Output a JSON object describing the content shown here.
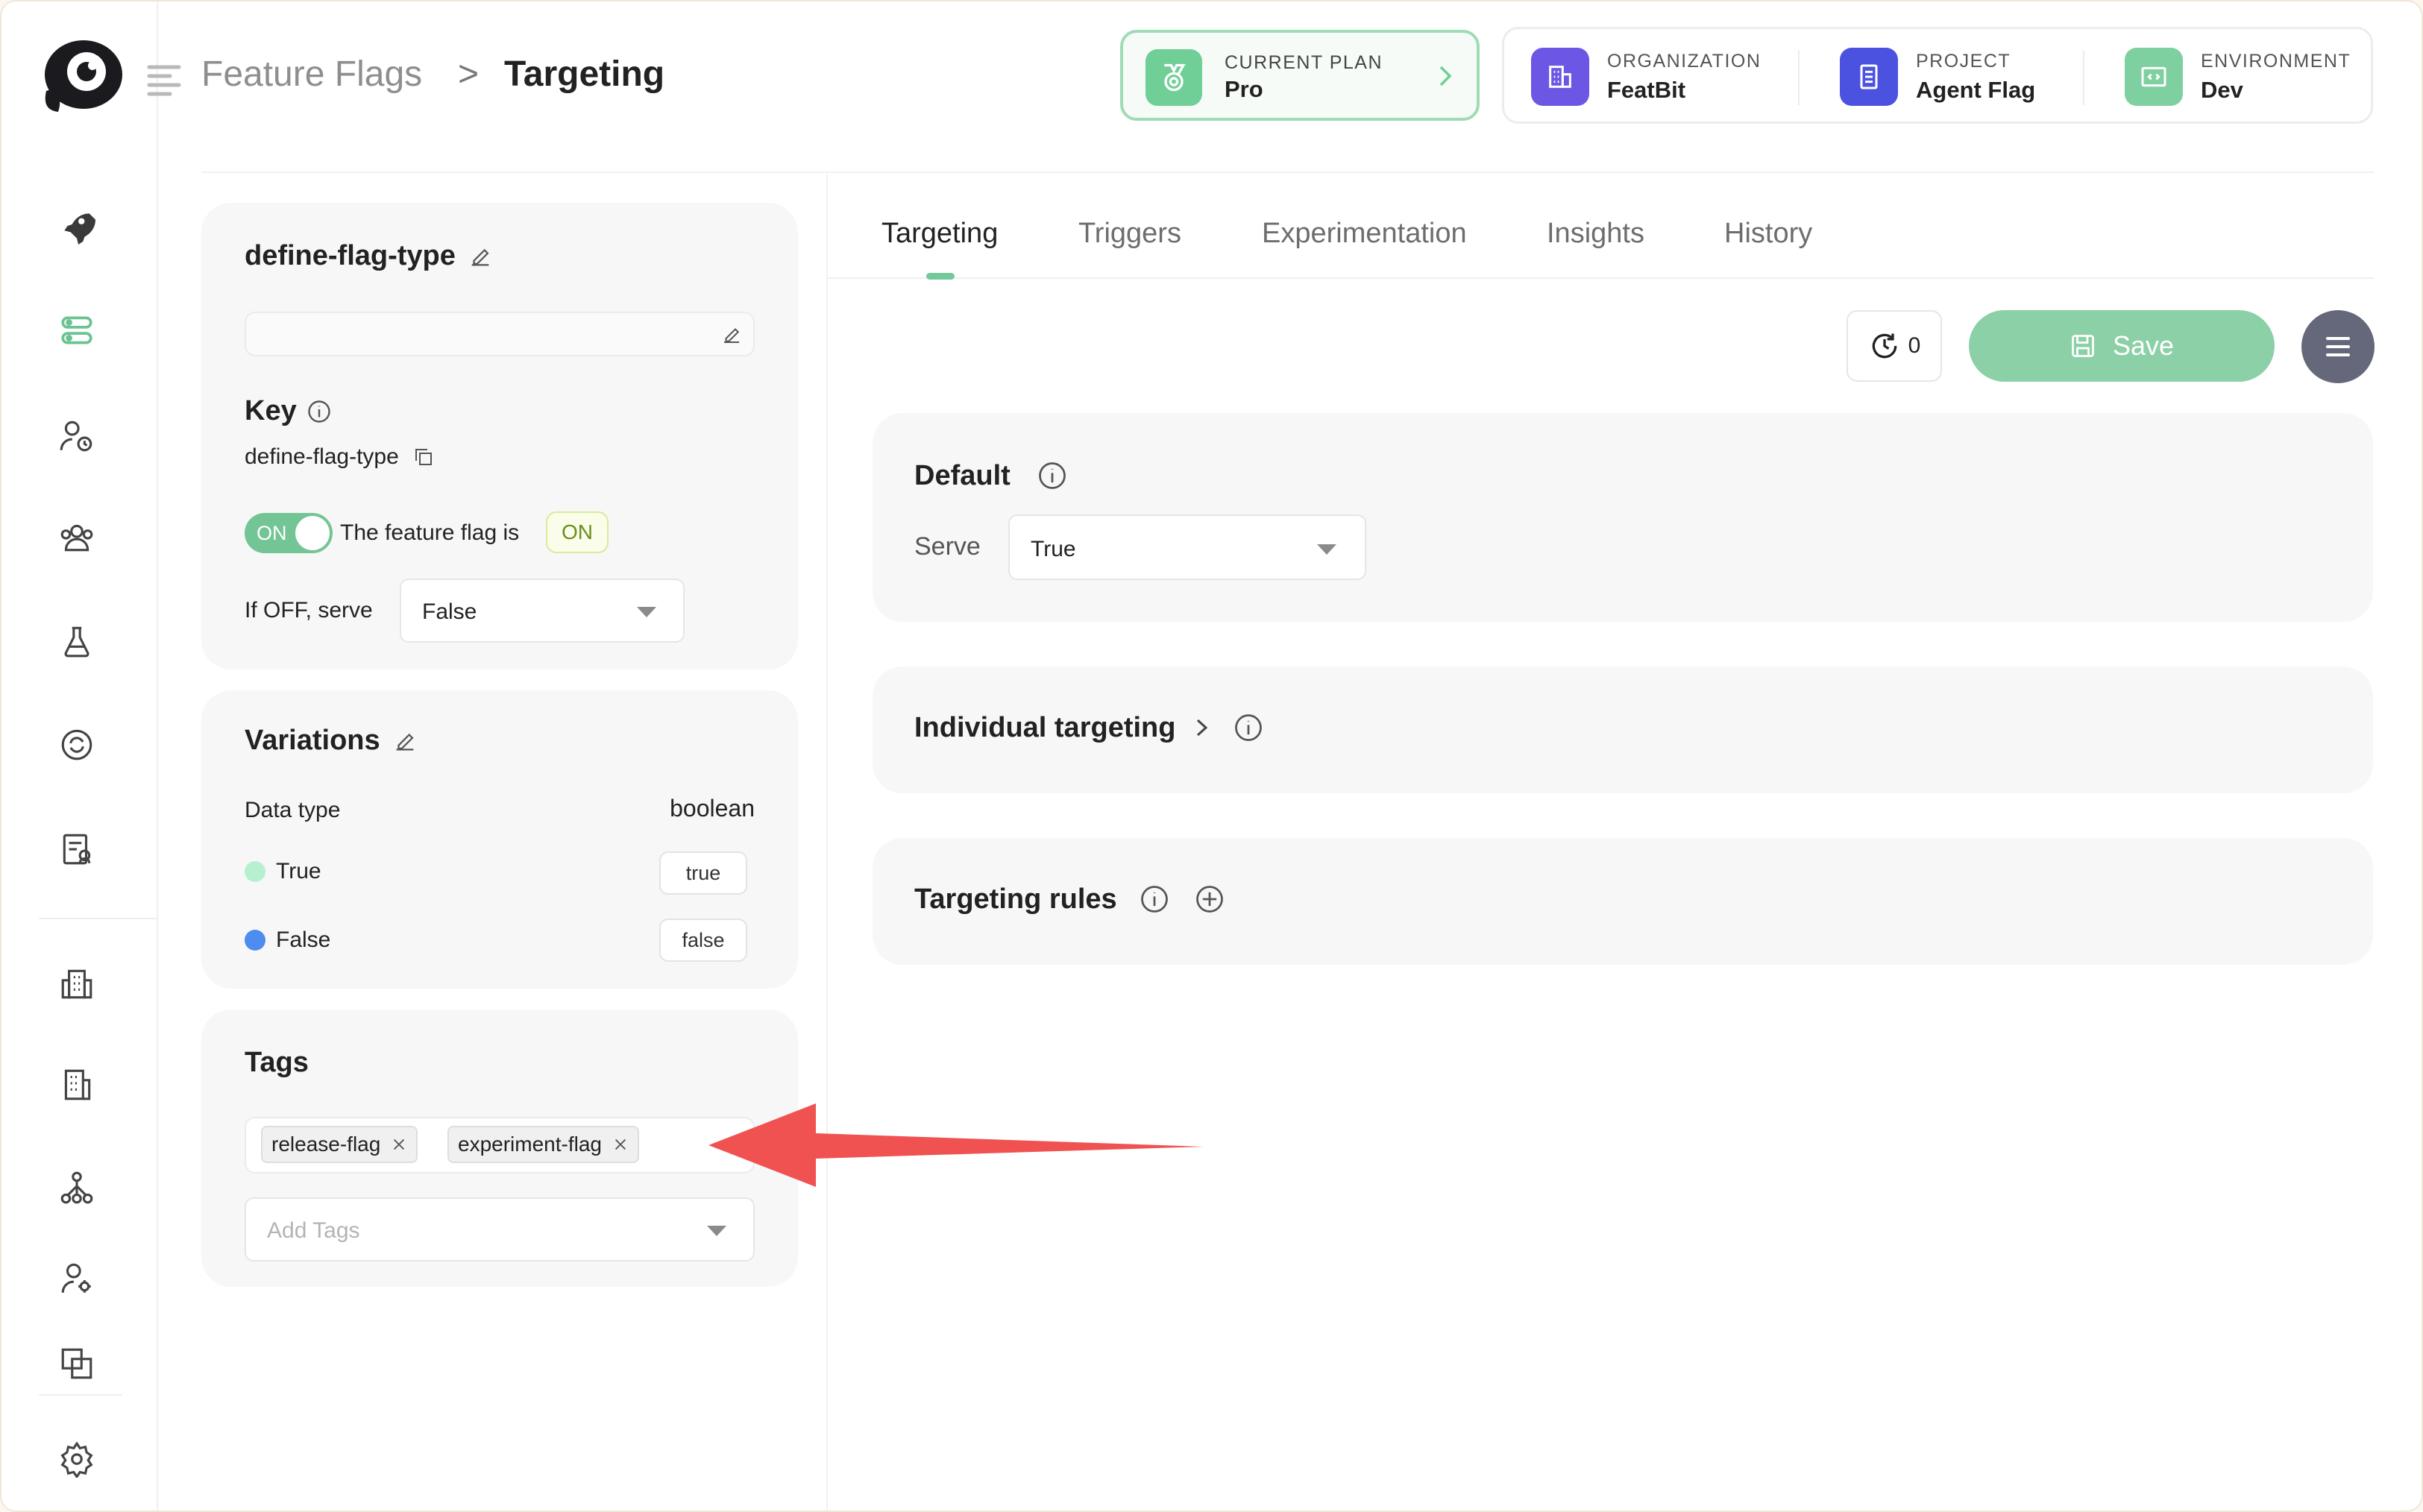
{
  "breadcrumb": {
    "section": "Feature Flags",
    "separator": ">",
    "current": "Targeting"
  },
  "plan": {
    "label": "CURRENT PLAN",
    "value": "Pro"
  },
  "context": {
    "organization": {
      "label": "ORGANIZATION",
      "value": "FeatBit"
    },
    "project": {
      "label": "PROJECT",
      "value": "Agent Flag"
    },
    "environment": {
      "label": "ENVIRONMENT",
      "value": "Dev"
    }
  },
  "flag": {
    "name": "define-flag-type",
    "description": "",
    "key_label": "Key",
    "key": "define-flag-type",
    "toggle_label": "ON",
    "status_text": "The feature flag is",
    "status_badge": "ON",
    "off_serve_label": "If OFF, serve",
    "off_serve_value": "False"
  },
  "variations": {
    "title": "Variations",
    "data_type_label": "Data type",
    "data_type": "boolean",
    "items": [
      {
        "name": "True",
        "value": "true",
        "color": "#b7f0cf"
      },
      {
        "name": "False",
        "value": "false",
        "color": "#4e8cf0"
      }
    ]
  },
  "tags": {
    "title": "Tags",
    "items": [
      "release-flag",
      "experiment-flag"
    ],
    "placeholder": "Add Tags"
  },
  "tabs": [
    "Targeting",
    "Triggers",
    "Experimentation",
    "Insights",
    "History"
  ],
  "toolbar": {
    "history_count": "0",
    "save_label": "Save"
  },
  "default_section": {
    "title": "Default",
    "serve_label": "Serve",
    "serve_value": "True"
  },
  "individual_section": {
    "title": "Individual targeting"
  },
  "rules_section": {
    "title": "Targeting rules"
  },
  "colors": {
    "accent": "#74c899",
    "annotation_arrow": "#f05252"
  }
}
